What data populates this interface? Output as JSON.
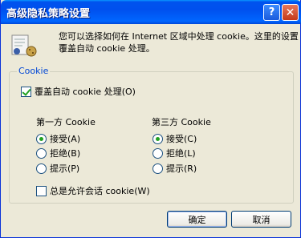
{
  "window": {
    "title": "高级隐私策略设置"
  },
  "titlebar": {
    "help_label": "?",
    "close_label": "✕"
  },
  "description": "您可以选择如何在 Internet 区域中处理 cookie。这里的设置覆盖自动 cookie 处理。",
  "group": {
    "title": "Cookie",
    "override_label": "覆盖自动 cookie 处理(O)",
    "override_checked": true,
    "first_party": {
      "heading": "第一方 Cookie",
      "options": [
        "接受(A)",
        "拒绝(B)",
        "提示(P)"
      ],
      "selected": 0
    },
    "third_party": {
      "heading": "第三方 Cookie",
      "options": [
        "接受(C)",
        "拒绝(L)",
        "提示(R)"
      ],
      "selected": 0
    },
    "session_label": "总是允许会话 cookie(W)",
    "session_checked": false
  },
  "buttons": {
    "ok": "确定",
    "cancel": "取消"
  },
  "icons": {
    "info": "cookie-privacy-icon"
  }
}
